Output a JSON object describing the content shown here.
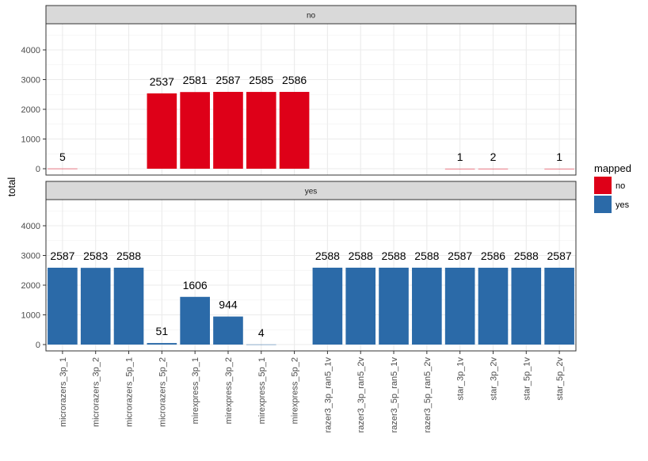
{
  "chart_data": {
    "type": "bar",
    "ylabel": "total",
    "ylim": [
      0,
      4800
    ],
    "yticks": [
      0,
      1000,
      2000,
      3000,
      4000
    ],
    "grid": true,
    "legend_position": "right",
    "legend": {
      "title": "mapped",
      "entries": [
        {
          "label": "no",
          "color": "#de0018"
        },
        {
          "label": "yes",
          "color": "#2b6aa8"
        }
      ]
    },
    "categories": [
      "microrazers_3p_1",
      "microrazers_3p_2",
      "microrazers_5p_1",
      "microrazers_5p_2",
      "mirexpress_3p_1",
      "mirexpress_3p_2",
      "mirexpress_5p_1",
      "mirexpress_5p_2",
      "razer3_3p_ran5_1v",
      "razer3_3p_ran5_2v",
      "razer3_5p_ran5_1v",
      "razer3_5p_ran5_2v",
      "star_3p_1v",
      "star_3p_2v",
      "star_5p_1v",
      "star_5p_2v"
    ],
    "facets": [
      {
        "label": "no",
        "color": "#de0018",
        "values": [
          null,
          5,
          null,
          null,
          2537,
          2581,
          2587,
          2585,
          2586,
          null,
          null,
          null,
          null,
          1,
          2,
          null,
          1
        ]
      },
      {
        "label": "yes",
        "color": "#2b6aa8",
        "values": [
          2587,
          2583,
          2588,
          51,
          1606,
          944,
          4,
          null,
          2588,
          2588,
          2588,
          2588,
          2587,
          2586,
          2588,
          2587
        ]
      }
    ]
  }
}
